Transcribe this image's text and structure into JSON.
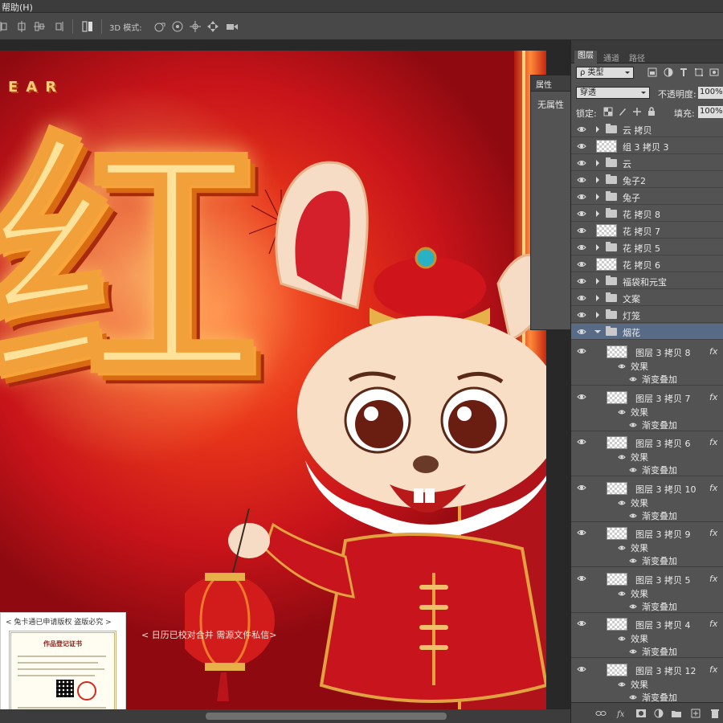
{
  "menubar": {
    "help": "帮助(H)"
  },
  "options_bar": {
    "mode_label": "3D 模式:"
  },
  "canvas": {
    "headline": "红",
    "year_text": "EAR",
    "caption": "< 日历已校对合并 需源文件私信>",
    "watermark_title": "< 兔卡通已申请版权 盗版必究 >",
    "certificate_heading": "作品登记证书"
  },
  "properties": {
    "tab": "属性",
    "body": "无属性"
  },
  "layers_panel": {
    "tabs": [
      "图层",
      "通道",
      "路径"
    ],
    "filter": "ρ 类型",
    "blend_mode": "穿透",
    "opacity_label": "不透明度:",
    "opacity_value": "100%",
    "lock_label": "锁定:",
    "fill_label": "填充:",
    "fill_value": "100%",
    "layers": [
      {
        "name": "云 拷贝",
        "type": "group"
      },
      {
        "name": "组 3 拷贝 3",
        "type": "layer"
      },
      {
        "name": "云",
        "type": "group"
      },
      {
        "name": "兔子2",
        "type": "group"
      },
      {
        "name": "兔子",
        "type": "group"
      },
      {
        "name": "花 拷贝 8",
        "type": "group"
      },
      {
        "name": "花 拷贝 7",
        "type": "layer"
      },
      {
        "name": "花 拷贝 5",
        "type": "group"
      },
      {
        "name": "花 拷贝 6",
        "type": "layer"
      },
      {
        "name": "福袋和元宝",
        "type": "group"
      },
      {
        "name": "文案",
        "type": "group"
      },
      {
        "name": "灯笼",
        "type": "group"
      },
      {
        "name": "烟花",
        "type": "group-open",
        "selected": true
      }
    ],
    "sublayers": [
      {
        "name": "图层 3 拷贝 8",
        "effects": "效果",
        "gradient": "渐变叠加",
        "fx": "fx"
      },
      {
        "name": "图层 3 拷贝 7",
        "effects": "效果",
        "gradient": "渐变叠加",
        "fx": "fx"
      },
      {
        "name": "图层 3 拷贝 6",
        "effects": "效果",
        "gradient": "渐变叠加",
        "fx": "fx"
      },
      {
        "name": "图层 3 拷贝 10",
        "effects": "效果",
        "gradient": "渐变叠加",
        "fx": "fx"
      },
      {
        "name": "图层 3 拷贝 9",
        "effects": "效果",
        "gradient": "渐变叠加",
        "fx": "fx"
      },
      {
        "name": "图层 3 拷贝 5",
        "effects": "效果",
        "gradient": "渐变叠加",
        "fx": "fx"
      },
      {
        "name": "图层 3 拷贝 4",
        "effects": "效果",
        "gradient": "渐变叠加",
        "fx": "fx"
      },
      {
        "name": "图层 3 拷贝 12",
        "effects": "效果",
        "gradient": "渐变叠加",
        "fx": "fx"
      }
    ]
  },
  "colors": {
    "panel": "#535353",
    "selected_row": "#576a86",
    "art_red": "#c8141a"
  },
  "icons": [
    "align-icon",
    "distribute-icon",
    "3d-rotate-icon",
    "3d-roll-icon",
    "3d-pan-icon",
    "3d-slide-icon",
    "3d-camera-icon",
    "eye-icon",
    "folder-icon",
    "link-icon",
    "fx-icon",
    "mask-icon",
    "adjustment-icon",
    "new-group-icon",
    "new-layer-icon",
    "trash-icon"
  ]
}
